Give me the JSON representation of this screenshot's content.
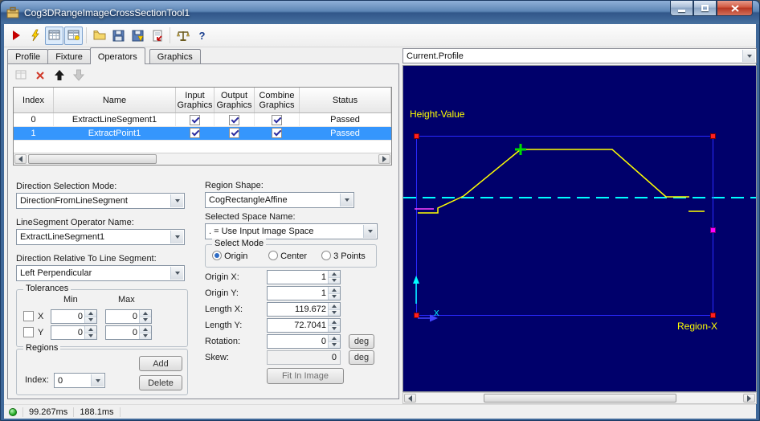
{
  "window": {
    "title": "Cog3DRangeImageCrossSectionTool1"
  },
  "icons": {
    "toolbar_names": [
      "run",
      "trigger",
      "results-grid",
      "grid-add",
      "open",
      "save",
      "save-as",
      "import",
      "calibrate",
      "help"
    ],
    "help_glyph": "?"
  },
  "tabs": {
    "items": [
      {
        "label": "Profile",
        "active": false
      },
      {
        "label": "Fixture",
        "active": false
      },
      {
        "label": "Operators",
        "active": true
      },
      {
        "label": "Graphics",
        "active": false
      }
    ]
  },
  "operators": {
    "columns": {
      "index": "Index",
      "name": "Name",
      "input": "Input Graphics",
      "output": "Output Graphics",
      "combine": "Combine Graphics",
      "status": "Status"
    },
    "rows": [
      {
        "index": "0",
        "name": "ExtractLineSegment1",
        "input_checked": true,
        "output_checked": true,
        "combine_checked": true,
        "status": "Passed",
        "selected": false
      },
      {
        "index": "1",
        "name": "ExtractPoint1",
        "input_checked": true,
        "output_checked": true,
        "combine_checked": true,
        "status": "Passed",
        "selected": true
      }
    ]
  },
  "left_form": {
    "direction_mode_label": "Direction Selection Mode:",
    "direction_mode_value": "DirectionFromLineSegment",
    "operator_name_label": "LineSegment Operator Name:",
    "operator_name_value": "ExtractLineSegment1",
    "direction_relative_label": "Direction Relative To Line Segment:",
    "direction_relative_value": "Left Perpendicular",
    "tolerances": {
      "title": "Tolerances",
      "min": "Min",
      "max": "Max",
      "x_label": "X",
      "y_label": "Y",
      "x_min": "0",
      "x_max": "0",
      "y_min": "0",
      "y_max": "0"
    },
    "regions": {
      "title": "Regions",
      "index_label": "Index:",
      "index_value": "0",
      "add": "Add",
      "delete": "Delete"
    }
  },
  "region_form": {
    "shape_label": "Region Shape:",
    "shape_value": "CogRectangleAffine",
    "space_label": "Selected Space Name:",
    "space_value": ". = Use Input Image Space",
    "select_mode": {
      "title": "Select Mode",
      "options": [
        {
          "label": "Origin",
          "selected": true
        },
        {
          "label": "Center",
          "selected": false
        },
        {
          "label": "3 Points",
          "selected": false
        }
      ]
    },
    "origin_x_label": "Origin X:",
    "origin_x": "1",
    "origin_y_label": "Origin Y:",
    "origin_y": "1",
    "length_x_label": "Length X:",
    "length_x": "119.672",
    "length_y_label": "Length Y:",
    "length_y": "72.7041",
    "rotation_label": "Rotation:",
    "rotation": "0",
    "rotation_unit": "deg",
    "skew_label": "Skew:",
    "skew": "0",
    "skew_unit": "deg",
    "fit_label": "Fit In Image"
  },
  "display": {
    "source_selector": "Current.Profile",
    "y_axis_label": "Height-Value",
    "x_axis_label": "Region-X",
    "x_marker": "X",
    "profile_points": "18,183 43,183 43,177 75,162 146,104 260,104 327,163 356,163",
    "colors": {
      "background": "#00006b",
      "profile": "#ffff00",
      "region": "#2a2aff",
      "handles": "#ff0000",
      "mid_handle": "#ff00ff",
      "section_line": "#00ffff",
      "marker": "#00dd00"
    }
  },
  "chart_data": {
    "type": "line",
    "title": "Current.Profile",
    "xlabel": "Region-X",
    "ylabel": "Height-Value",
    "region": {
      "origin_x": 1,
      "origin_y": 1,
      "length_x": 119.672,
      "length_y": 72.7041,
      "rotation_deg": 0,
      "skew_deg": 0
    },
    "series": [
      {
        "name": "profile",
        "x": [
          0.7,
          8.8,
          8.8,
          19.1,
          42.2,
          79.1,
          100.9,
          110.3
        ],
        "y": [
          41.4,
          41.4,
          43.4,
          48.3,
          67.2,
          67.2,
          47.9,
          47.9
        ]
      }
    ]
  },
  "status_bar": {
    "run_time": "99.267ms",
    "total_time": "188.1ms"
  }
}
